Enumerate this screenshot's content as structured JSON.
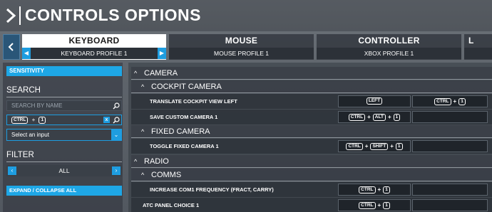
{
  "header": {
    "title": "CONTROLS OPTIONS",
    "logo_icon": "chevron-logo-icon"
  },
  "tabs": [
    {
      "label": "KEYBOARD",
      "profile": "KEYBOARD PROFILE 1",
      "active": true
    },
    {
      "label": "MOUSE",
      "profile": "MOUSE PROFILE 1",
      "active": false
    },
    {
      "label": "CONTROLLER",
      "profile": "XBOX PROFILE 1",
      "active": false
    },
    {
      "label": "L",
      "profile": "",
      "active": false
    }
  ],
  "sidebar": {
    "sensitivity_label": "SENSITIVITY",
    "search_heading": "SEARCH",
    "search_placeholder": "SEARCH BY NAME",
    "input_search": {
      "keys": [
        "CTRL",
        "1"
      ]
    },
    "select_value": "Select an input",
    "filter_heading": "FILTER",
    "filter_value": "ALL",
    "expand_label": "EXPAND / COLLAPSE ALL"
  },
  "list": {
    "camera": "CAMERA",
    "cockpit_camera": "COCKPIT CAMERA",
    "translate_left": "TRANSLATE COCKPIT VIEW LEFT",
    "save_custom": "SAVE CUSTOM CAMERA 1",
    "fixed_camera": "FIXED CAMERA",
    "toggle_fixed": "TOGGLE FIXED CAMERA 1",
    "radio": "RADIO",
    "comms": "COMMS",
    "increase_com1": "INCREASE COM1 FREQUENCY (FRACT, CARRY)",
    "atc_panel": "ATC PANEL CHOICE 1",
    "keys": {
      "left": "LEFT",
      "ctrl": "CTRL",
      "alt": "ALT",
      "shift": "SHIFT",
      "one": "1"
    }
  },
  "colors": {
    "accent": "#1ea7e6",
    "active_tab_bg": "#ffffff"
  }
}
